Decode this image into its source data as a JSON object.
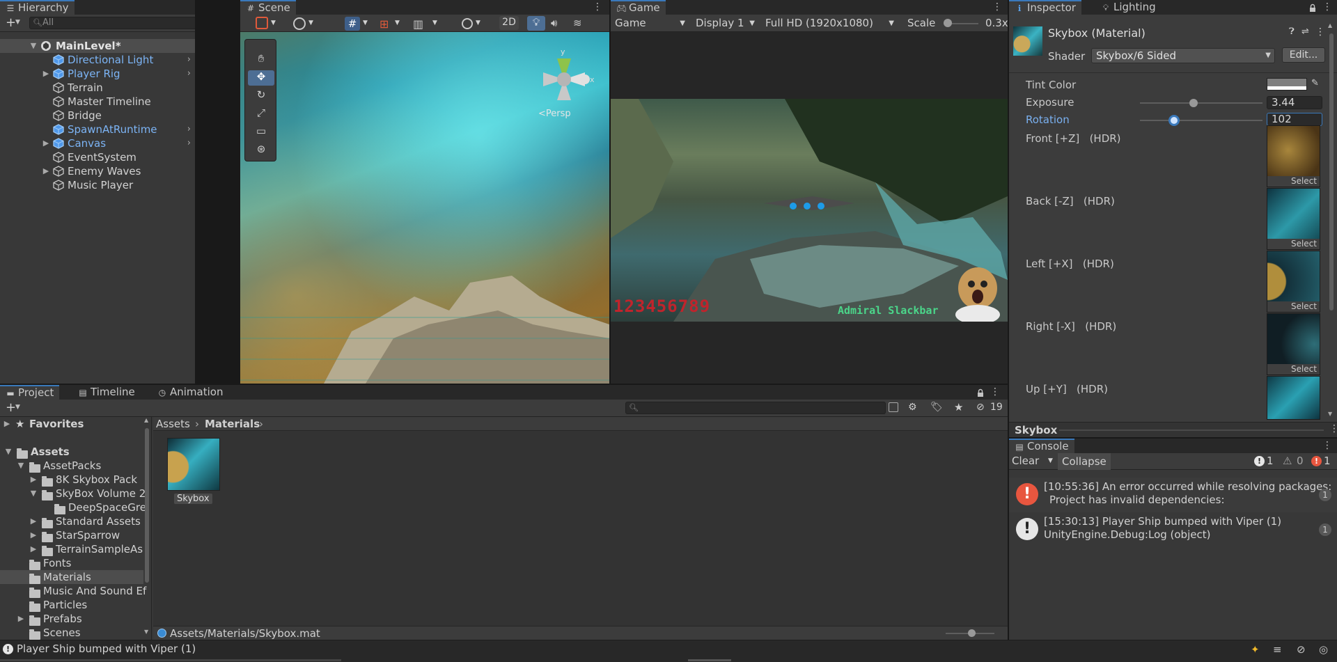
{
  "hierarchy": {
    "tab_label": "Hierarchy",
    "search_placeholder": "All",
    "scene_name": "MainLevel*",
    "items": [
      {
        "label": "Directional Light",
        "prefab": true,
        "expandable": false,
        "chevron": true
      },
      {
        "label": "Player Rig",
        "prefab": true,
        "expandable": true,
        "chevron": true
      },
      {
        "label": "Terrain",
        "prefab": false,
        "expandable": false,
        "chevron": false
      },
      {
        "label": "Master Timeline",
        "prefab": false,
        "expandable": false,
        "chevron": false
      },
      {
        "label": "Bridge",
        "prefab": false,
        "expandable": false,
        "chevron": false
      },
      {
        "label": "SpawnAtRuntime",
        "prefab": true,
        "expandable": false,
        "chevron": true
      },
      {
        "label": "Canvas",
        "prefab": true,
        "expandable": true,
        "chevron": true
      },
      {
        "label": "EventSystem",
        "prefab": false,
        "expandable": false,
        "chevron": false
      },
      {
        "label": "Enemy Waves",
        "prefab": false,
        "expandable": true,
        "chevron": false
      },
      {
        "label": "Music Player",
        "prefab": false,
        "expandable": false,
        "chevron": false
      }
    ]
  },
  "scene": {
    "tab_label": "Scene",
    "btn_2d": "2D",
    "gizmo_label": "<Persp",
    "axis_x": "x",
    "axis_y": "y"
  },
  "game": {
    "tab_label": "Game",
    "mode": "Game",
    "display": "Display 1",
    "resolution": "Full HD (1920x1080)",
    "scale_label": "Scale",
    "scale_value": "0.3x",
    "hud_score": "123456789",
    "hud_name": "Admiral Slackbar"
  },
  "inspector": {
    "tab_label": "Inspector",
    "lighting_tab_label": "Lighting",
    "title": "Skybox (Material)",
    "shader_label": "Shader",
    "shader_value": "Skybox/6 Sided",
    "edit_button": "Edit...",
    "tint_label": "Tint Color",
    "exposure_label": "Exposure",
    "exposure_value": "3.44",
    "exposure_fraction": 0.44,
    "rotation_label": "Rotation",
    "rotation_value": "102",
    "rotation_fraction": 0.28,
    "select_label": "Select",
    "faces": [
      {
        "label": "Front [+Z]",
        "hdr": "(HDR)"
      },
      {
        "label": "Back [-Z]",
        "hdr": "(HDR)"
      },
      {
        "label": "Left [+X]",
        "hdr": "(HDR)"
      },
      {
        "label": "Right [-X]",
        "hdr": "(HDR)"
      },
      {
        "label": "Up [+Y]",
        "hdr": "(HDR)"
      }
    ],
    "preview_label": "Skybox"
  },
  "project": {
    "tab_label": "Project",
    "timeline_tab_label": "Timeline",
    "animation_tab_label": "Animation",
    "hidden_count": "19",
    "favorites_label": "Favorites",
    "tree": [
      {
        "label": "Assets",
        "indent": 0,
        "expanded": true,
        "arrow": true
      },
      {
        "label": "AssetPacks",
        "indent": 1,
        "expanded": true,
        "arrow": true
      },
      {
        "label": "8K Skybox Pack",
        "indent": 2,
        "expanded": false,
        "arrow": true
      },
      {
        "label": "SkyBox Volume 2",
        "indent": 2,
        "expanded": true,
        "arrow": true
      },
      {
        "label": "DeepSpaceGre",
        "indent": 3,
        "expanded": false,
        "arrow": false
      },
      {
        "label": "Standard Assets",
        "indent": 2,
        "expanded": false,
        "arrow": true
      },
      {
        "label": "StarSparrow",
        "indent": 2,
        "expanded": false,
        "arrow": true
      },
      {
        "label": "TerrainSampleAs",
        "indent": 2,
        "expanded": false,
        "arrow": true
      },
      {
        "label": "Fonts",
        "indent": 1,
        "expanded": false,
        "arrow": false
      },
      {
        "label": "Materials",
        "indent": 1,
        "expanded": false,
        "arrow": false,
        "selected": true
      },
      {
        "label": "Music And Sound Ef",
        "indent": 1,
        "expanded": false,
        "arrow": false
      },
      {
        "label": "Particles",
        "indent": 1,
        "expanded": false,
        "arrow": false
      },
      {
        "label": "Prefabs",
        "indent": 1,
        "expanded": false,
        "arrow": true
      },
      {
        "label": "Scenes",
        "indent": 1,
        "expanded": false,
        "arrow": false
      }
    ],
    "breadcrumb": [
      "Assets",
      "Materials"
    ],
    "asset_name": "Skybox",
    "path": "Assets/Materials/Skybox.mat"
  },
  "console": {
    "tab_label": "Console",
    "clear_label": "Clear",
    "collapse_label": "Collapse",
    "log_count": "1",
    "warn_count": "0",
    "error_count": "1",
    "entries": [
      {
        "line1": "[10:55:36] An error occurred while resolving packages:",
        "line2": "Project has invalid dependencies:",
        "count": "1",
        "kind": "error"
      },
      {
        "line1": "[15:30:13] Player Ship bumped with Viper (1)",
        "line2": "UnityEngine.Debug:Log (object)",
        "count": "1",
        "kind": "log"
      }
    ]
  },
  "status_bar": {
    "message": "Player Ship bumped with Viper (1)"
  },
  "colors": {
    "accent": "#3a79bb",
    "prefab_text": "#7cb4f5",
    "error": "#e8563f"
  }
}
